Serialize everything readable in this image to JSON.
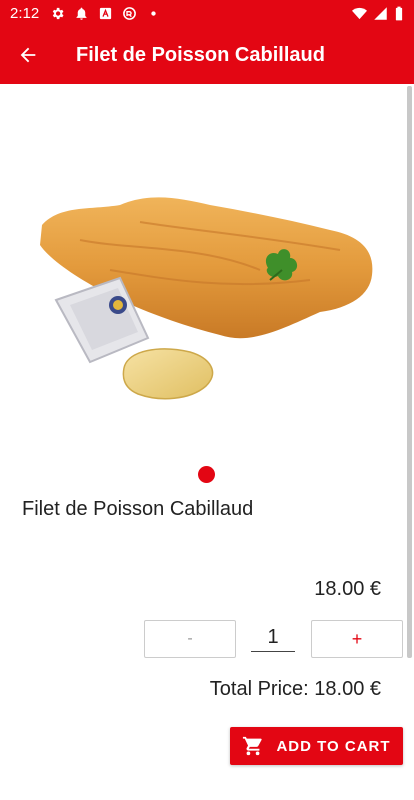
{
  "status_bar": {
    "time": "2:12",
    "background": "#e30613",
    "icons_left": [
      "gear-icon",
      "bell-icon",
      "news-icon",
      "vpn-icon",
      "dot-icon"
    ],
    "icons_right": [
      "wifi-icon",
      "signal-icon",
      "battery-icon"
    ]
  },
  "app_bar": {
    "title": "Filet de Poisson Cabillaud",
    "background": "#e30613",
    "back_icon": "arrow-back-icon"
  },
  "product": {
    "name": "Filet de Poisson Cabillaud",
    "image": "fried-fish-fillet-image",
    "unit_price": "18.00 €",
    "pager_dot_color": "#e30613"
  },
  "quantity": {
    "minus_label": "-",
    "value": "1",
    "plus_label": "+"
  },
  "total": {
    "label": "Total Price: 18.00 €"
  },
  "cart_button": {
    "label": "ADD TO CART",
    "icon": "cart-icon",
    "color": "#e30613"
  }
}
